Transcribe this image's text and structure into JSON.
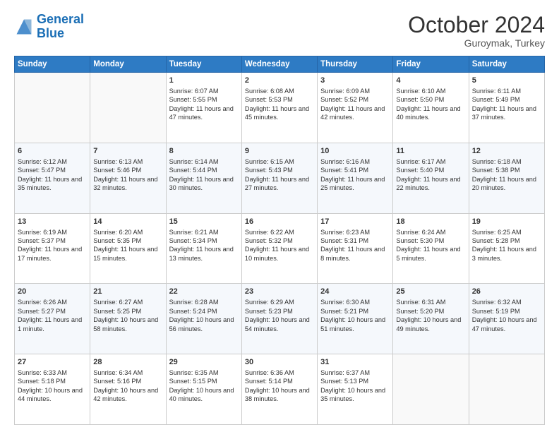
{
  "logo": {
    "line1": "General",
    "line2": "Blue"
  },
  "header": {
    "month": "October 2024",
    "location": "Guroymak, Turkey"
  },
  "days_of_week": [
    "Sunday",
    "Monday",
    "Tuesday",
    "Wednesday",
    "Thursday",
    "Friday",
    "Saturday"
  ],
  "weeks": [
    [
      {
        "day": "",
        "info": ""
      },
      {
        "day": "",
        "info": ""
      },
      {
        "day": "1",
        "info": "Sunrise: 6:07 AM\nSunset: 5:55 PM\nDaylight: 11 hours and 47 minutes."
      },
      {
        "day": "2",
        "info": "Sunrise: 6:08 AM\nSunset: 5:53 PM\nDaylight: 11 hours and 45 minutes."
      },
      {
        "day": "3",
        "info": "Sunrise: 6:09 AM\nSunset: 5:52 PM\nDaylight: 11 hours and 42 minutes."
      },
      {
        "day": "4",
        "info": "Sunrise: 6:10 AM\nSunset: 5:50 PM\nDaylight: 11 hours and 40 minutes."
      },
      {
        "day": "5",
        "info": "Sunrise: 6:11 AM\nSunset: 5:49 PM\nDaylight: 11 hours and 37 minutes."
      }
    ],
    [
      {
        "day": "6",
        "info": "Sunrise: 6:12 AM\nSunset: 5:47 PM\nDaylight: 11 hours and 35 minutes."
      },
      {
        "day": "7",
        "info": "Sunrise: 6:13 AM\nSunset: 5:46 PM\nDaylight: 11 hours and 32 minutes."
      },
      {
        "day": "8",
        "info": "Sunrise: 6:14 AM\nSunset: 5:44 PM\nDaylight: 11 hours and 30 minutes."
      },
      {
        "day": "9",
        "info": "Sunrise: 6:15 AM\nSunset: 5:43 PM\nDaylight: 11 hours and 27 minutes."
      },
      {
        "day": "10",
        "info": "Sunrise: 6:16 AM\nSunset: 5:41 PM\nDaylight: 11 hours and 25 minutes."
      },
      {
        "day": "11",
        "info": "Sunrise: 6:17 AM\nSunset: 5:40 PM\nDaylight: 11 hours and 22 minutes."
      },
      {
        "day": "12",
        "info": "Sunrise: 6:18 AM\nSunset: 5:38 PM\nDaylight: 11 hours and 20 minutes."
      }
    ],
    [
      {
        "day": "13",
        "info": "Sunrise: 6:19 AM\nSunset: 5:37 PM\nDaylight: 11 hours and 17 minutes."
      },
      {
        "day": "14",
        "info": "Sunrise: 6:20 AM\nSunset: 5:35 PM\nDaylight: 11 hours and 15 minutes."
      },
      {
        "day": "15",
        "info": "Sunrise: 6:21 AM\nSunset: 5:34 PM\nDaylight: 11 hours and 13 minutes."
      },
      {
        "day": "16",
        "info": "Sunrise: 6:22 AM\nSunset: 5:32 PM\nDaylight: 11 hours and 10 minutes."
      },
      {
        "day": "17",
        "info": "Sunrise: 6:23 AM\nSunset: 5:31 PM\nDaylight: 11 hours and 8 minutes."
      },
      {
        "day": "18",
        "info": "Sunrise: 6:24 AM\nSunset: 5:30 PM\nDaylight: 11 hours and 5 minutes."
      },
      {
        "day": "19",
        "info": "Sunrise: 6:25 AM\nSunset: 5:28 PM\nDaylight: 11 hours and 3 minutes."
      }
    ],
    [
      {
        "day": "20",
        "info": "Sunrise: 6:26 AM\nSunset: 5:27 PM\nDaylight: 11 hours and 1 minute."
      },
      {
        "day": "21",
        "info": "Sunrise: 6:27 AM\nSunset: 5:25 PM\nDaylight: 10 hours and 58 minutes."
      },
      {
        "day": "22",
        "info": "Sunrise: 6:28 AM\nSunset: 5:24 PM\nDaylight: 10 hours and 56 minutes."
      },
      {
        "day": "23",
        "info": "Sunrise: 6:29 AM\nSunset: 5:23 PM\nDaylight: 10 hours and 54 minutes."
      },
      {
        "day": "24",
        "info": "Sunrise: 6:30 AM\nSunset: 5:21 PM\nDaylight: 10 hours and 51 minutes."
      },
      {
        "day": "25",
        "info": "Sunrise: 6:31 AM\nSunset: 5:20 PM\nDaylight: 10 hours and 49 minutes."
      },
      {
        "day": "26",
        "info": "Sunrise: 6:32 AM\nSunset: 5:19 PM\nDaylight: 10 hours and 47 minutes."
      }
    ],
    [
      {
        "day": "27",
        "info": "Sunrise: 6:33 AM\nSunset: 5:18 PM\nDaylight: 10 hours and 44 minutes."
      },
      {
        "day": "28",
        "info": "Sunrise: 6:34 AM\nSunset: 5:16 PM\nDaylight: 10 hours and 42 minutes."
      },
      {
        "day": "29",
        "info": "Sunrise: 6:35 AM\nSunset: 5:15 PM\nDaylight: 10 hours and 40 minutes."
      },
      {
        "day": "30",
        "info": "Sunrise: 6:36 AM\nSunset: 5:14 PM\nDaylight: 10 hours and 38 minutes."
      },
      {
        "day": "31",
        "info": "Sunrise: 6:37 AM\nSunset: 5:13 PM\nDaylight: 10 hours and 35 minutes."
      },
      {
        "day": "",
        "info": ""
      },
      {
        "day": "",
        "info": ""
      }
    ]
  ]
}
